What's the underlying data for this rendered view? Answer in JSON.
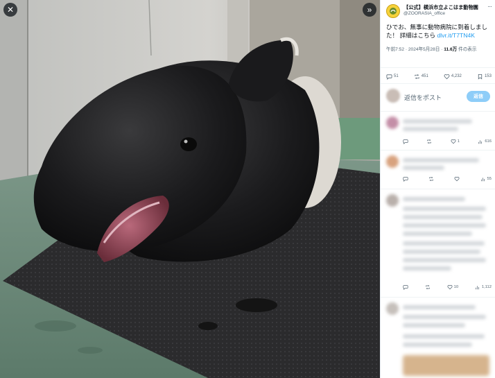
{
  "viewer": {
    "close_icon": "close-icon",
    "expand_icon": "chevrons-right-icon",
    "close_glyph": "✕",
    "expand_glyph": "»"
  },
  "tweet": {
    "author_name": "【公式】横浜市立よこはま動物園",
    "author_handle": "@ZOORASIA_office",
    "more_glyph": "···",
    "text": "ひでお、無事に動物病院に到着しました！ 詳細はこちら ",
    "link": "dlvr.it/T7TN4K",
    "time": "午前7:52 · 2024年5月28日 · ",
    "views_count": "11.6万",
    "views_label": " 件の表示",
    "stats": {
      "replies": "51",
      "retweets": "451",
      "likes": "4,232",
      "bookmarks": "153"
    }
  },
  "reply_box": {
    "placeholder": "返信をポスト",
    "button": "返信"
  },
  "replies": [
    {
      "retweets": "",
      "likes": "1",
      "views": "616"
    },
    {
      "retweets": "",
      "likes": "",
      "views": "55"
    },
    {
      "retweets": "",
      "likes": "10",
      "views": "1,112"
    }
  ],
  "colors": {
    "link": "#1d9bf0",
    "reply_button": "#8ecdf8",
    "secondary_text": "#536471"
  }
}
